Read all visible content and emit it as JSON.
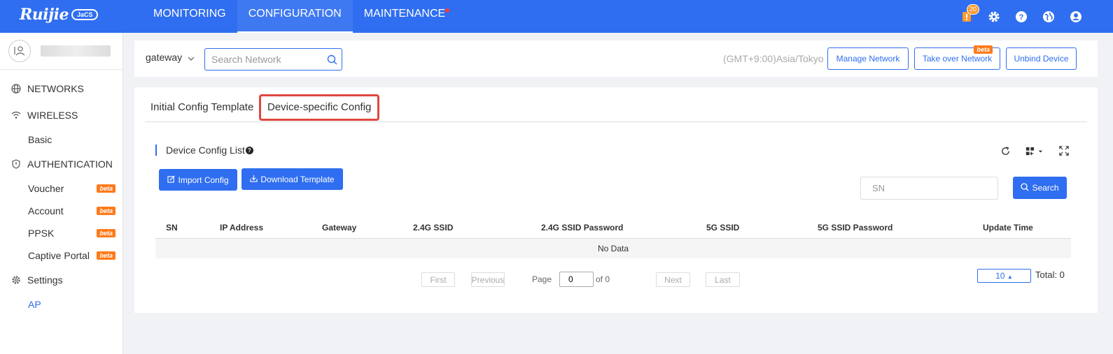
{
  "topbar": {
    "logo_text": "Ruijie",
    "logo_sub": "JaCS",
    "nav": [
      {
        "label": "MONITORING",
        "active": false
      },
      {
        "label": "CONFIGURATION",
        "active": true
      },
      {
        "label": "MAINTENANCE",
        "active": false,
        "dot": true
      }
    ],
    "notification_count": "20",
    "icons": [
      "notification-icon",
      "gear-icon",
      "help-icon",
      "globe-icon",
      "user-icon"
    ]
  },
  "sidebar": {
    "menu": [
      {
        "type": "group",
        "label": "NETWORKS",
        "icon": "globe-icon"
      },
      {
        "type": "group",
        "label": "WIRELESS",
        "icon": "wifi-icon"
      },
      {
        "type": "sub",
        "label": "Basic"
      },
      {
        "type": "group",
        "label": "AUTHENTICATION",
        "icon": "shield-icon"
      },
      {
        "type": "sub",
        "label": "Voucher",
        "beta": true
      },
      {
        "type": "sub",
        "label": "Account",
        "beta": true
      },
      {
        "type": "sub",
        "label": "PPSK",
        "beta": true
      },
      {
        "type": "sub",
        "label": "Captive Portal",
        "beta": true
      },
      {
        "type": "group",
        "label": "Settings",
        "icon": "gear-icon"
      },
      {
        "type": "sub",
        "label": "AP",
        "active": true
      }
    ],
    "beta_label": "beta"
  },
  "header": {
    "network": "gateway",
    "search_placeholder": "Search Network",
    "timezone": "(GMT+9:00)Asia/Tokyo",
    "buttons": {
      "manage": "Manage Network",
      "takeover": "Take over Network",
      "unbind": "Unbind Device"
    },
    "beta_label": "beta"
  },
  "main": {
    "tabs": [
      "Initial Config Template",
      "Device-specific Config"
    ],
    "section_title": "Device Config List",
    "import_label": "Import Config",
    "download_label": "Download Template",
    "sn_placeholder": "SN",
    "search_label": "Search",
    "columns": [
      "SN",
      "IP Address",
      "Gateway",
      "2.4G SSID",
      "2.4G SSID Password",
      "5G SSID",
      "5G SSID Password",
      "Update Time"
    ],
    "no_data": "No Data",
    "pager": {
      "first": "First",
      "previous": "Previous",
      "page_label": "Page",
      "page_value": "0",
      "of_label": "of 0",
      "next": "Next",
      "last": "Last",
      "page_size": "10",
      "total": "Total: 0"
    }
  }
}
